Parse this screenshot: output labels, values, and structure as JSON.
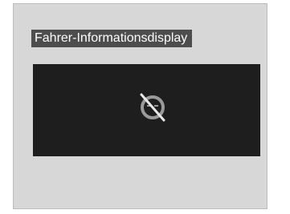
{
  "header": {
    "label": "Fahrer-Informationsdisplay"
  },
  "display": {
    "icon": "no-face-icon",
    "colors": {
      "panel": "#d7d7d7",
      "screen": "#1e1e1e",
      "label_bg": "#4d4d4d",
      "icon": "#9a9a9a",
      "slash": "#e8e8e8"
    }
  }
}
